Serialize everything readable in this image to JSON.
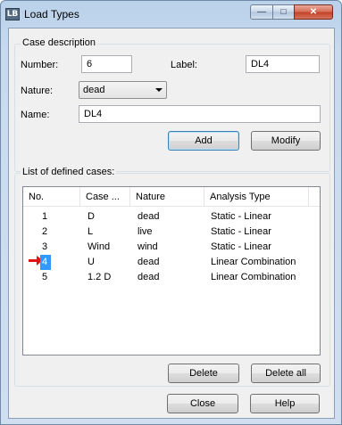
{
  "window": {
    "title": "Load Types",
    "app_icon_text": "LB",
    "minimize_glyph": "—",
    "maximize_glyph": "□",
    "close_glyph": "✕"
  },
  "case_description": {
    "legend": "Case description",
    "number_label": "Number:",
    "number_value": "6",
    "label_label": "Label:",
    "label_value": "DL4",
    "nature_label": "Nature:",
    "nature_value": "dead",
    "name_label": "Name:",
    "name_value": "DL4",
    "add_button": "Add",
    "modify_button": "Modify"
  },
  "defined_cases": {
    "legend": "List of defined cases:",
    "columns": [
      "No.",
      "Case ...",
      "Nature",
      "Analysis Type"
    ],
    "rows": [
      {
        "no": "1",
        "case": "D",
        "nature": "dead",
        "analysis": "Static - Linear"
      },
      {
        "no": "2",
        "case": "L",
        "nature": "live",
        "analysis": "Static - Linear"
      },
      {
        "no": "3",
        "case": "Wind",
        "nature": "wind",
        "analysis": "Static - Linear"
      },
      {
        "no": "4",
        "case": "U",
        "nature": "dead",
        "analysis": "Linear Combination"
      },
      {
        "no": "5",
        "case": "1.2 D",
        "nature": "dead",
        "analysis": "Linear Combination"
      }
    ],
    "selected_row": "4",
    "delete_button": "Delete",
    "delete_all_button": "Delete all"
  },
  "footer": {
    "close_button": "Close",
    "help_button": "Help"
  },
  "colors": {
    "selection": "#3399ff",
    "marker_arrow": "#e01414"
  }
}
